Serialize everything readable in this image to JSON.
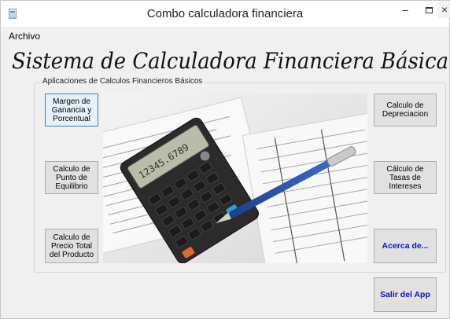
{
  "window": {
    "title": "Combo calculadora financiera",
    "minimize_glyph": "–",
    "close_glyph": "×"
  },
  "menu": {
    "items": [
      "Archivo"
    ]
  },
  "banner": {
    "heading": "Sistema de Calculadora Financiera Básica"
  },
  "group": {
    "legend": "Aplicaciones de Calculos Financieros Básicos"
  },
  "buttons": {
    "margen": "Margen de\nGanancia y\nPorcentual",
    "equilibrio": "Calculo de\nPunto de\nEquilibrio",
    "precio": "Calculo de\nPrecio Total\ndel Producto",
    "depreciacion": "Calculo de\nDepreciacion",
    "tasas": "Cálculo de\nTasas de\nIntereses",
    "acerca": "Acerca de...",
    "salir": "Salir del App"
  },
  "image": {
    "icon": "calculator-pen-documents-photo",
    "calculator_display": "12345.6789"
  },
  "colors": {
    "window_bg": "#f0f0f0",
    "button_face": "#e1e1e1",
    "focus_border": "#3c7fb1",
    "link_blue": "#0a14c8"
  }
}
